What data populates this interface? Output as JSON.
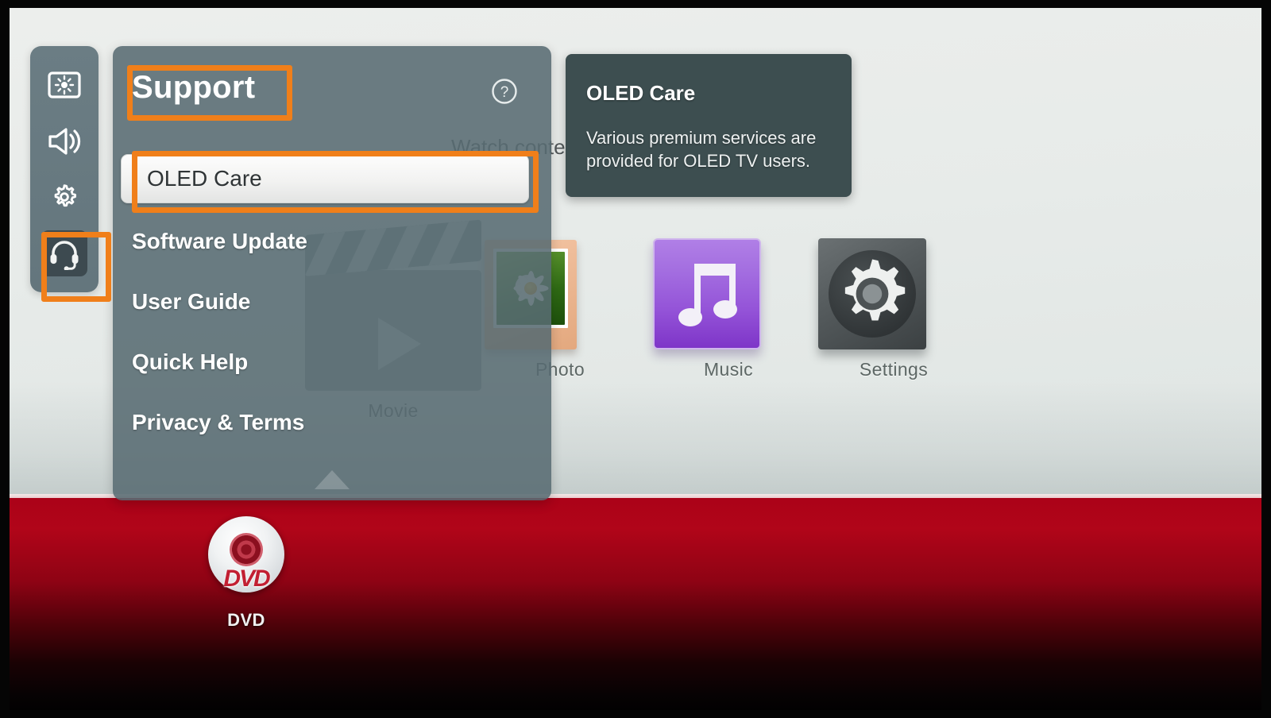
{
  "screen": {
    "background_desc_text": "Watch content from all connected devices."
  },
  "rail": {
    "items": [
      {
        "name": "picture-settings",
        "icon": "brightness-screen-icon",
        "active": false
      },
      {
        "name": "sound-settings",
        "icon": "speaker-icon",
        "active": false
      },
      {
        "name": "general-settings",
        "icon": "gear-icon",
        "active": false
      },
      {
        "name": "support",
        "icon": "headset-icon",
        "active": true
      }
    ]
  },
  "panel": {
    "title": "Support",
    "help_icon": "question-circle-icon",
    "items": [
      {
        "label": "OLED Care",
        "selected": true
      },
      {
        "label": "Software Update",
        "selected": false
      },
      {
        "label": "User Guide",
        "selected": false
      },
      {
        "label": "Quick Help",
        "selected": false
      },
      {
        "label": "Privacy & Terms",
        "selected": false
      }
    ],
    "scroll_indicator": "down-triangle-icon"
  },
  "tooltip": {
    "title": "OLED Care",
    "body": "Various premium services are provided for OLED TV users."
  },
  "apps": [
    {
      "id": "movie",
      "label": "Movie",
      "icon": "clapperboard-icon"
    },
    {
      "id": "photo",
      "label": "Photo",
      "icon": "picture-frame-icon"
    },
    {
      "id": "music",
      "label": "Music",
      "icon": "music-note-icon"
    },
    {
      "id": "settings",
      "label": "Settings",
      "icon": "gear-tile-icon"
    },
    {
      "id": "dvd",
      "label": "DVD",
      "icon": "dvd-disc-icon",
      "disc_text": "DVD"
    }
  ],
  "annotations": {
    "accent_color": "#f07f1a",
    "boxes": [
      {
        "target": "panel-title"
      },
      {
        "target": "menu-item-oled-care"
      },
      {
        "target": "rail-item-support"
      }
    ]
  },
  "colors": {
    "panel_bg": "#586b72",
    "rail_bg": "#677a81",
    "tooltip_bg": "#3d4e50",
    "accent_orange": "#f07f1a",
    "red_band": "#b10519",
    "screen_bg": "#e9edea"
  }
}
